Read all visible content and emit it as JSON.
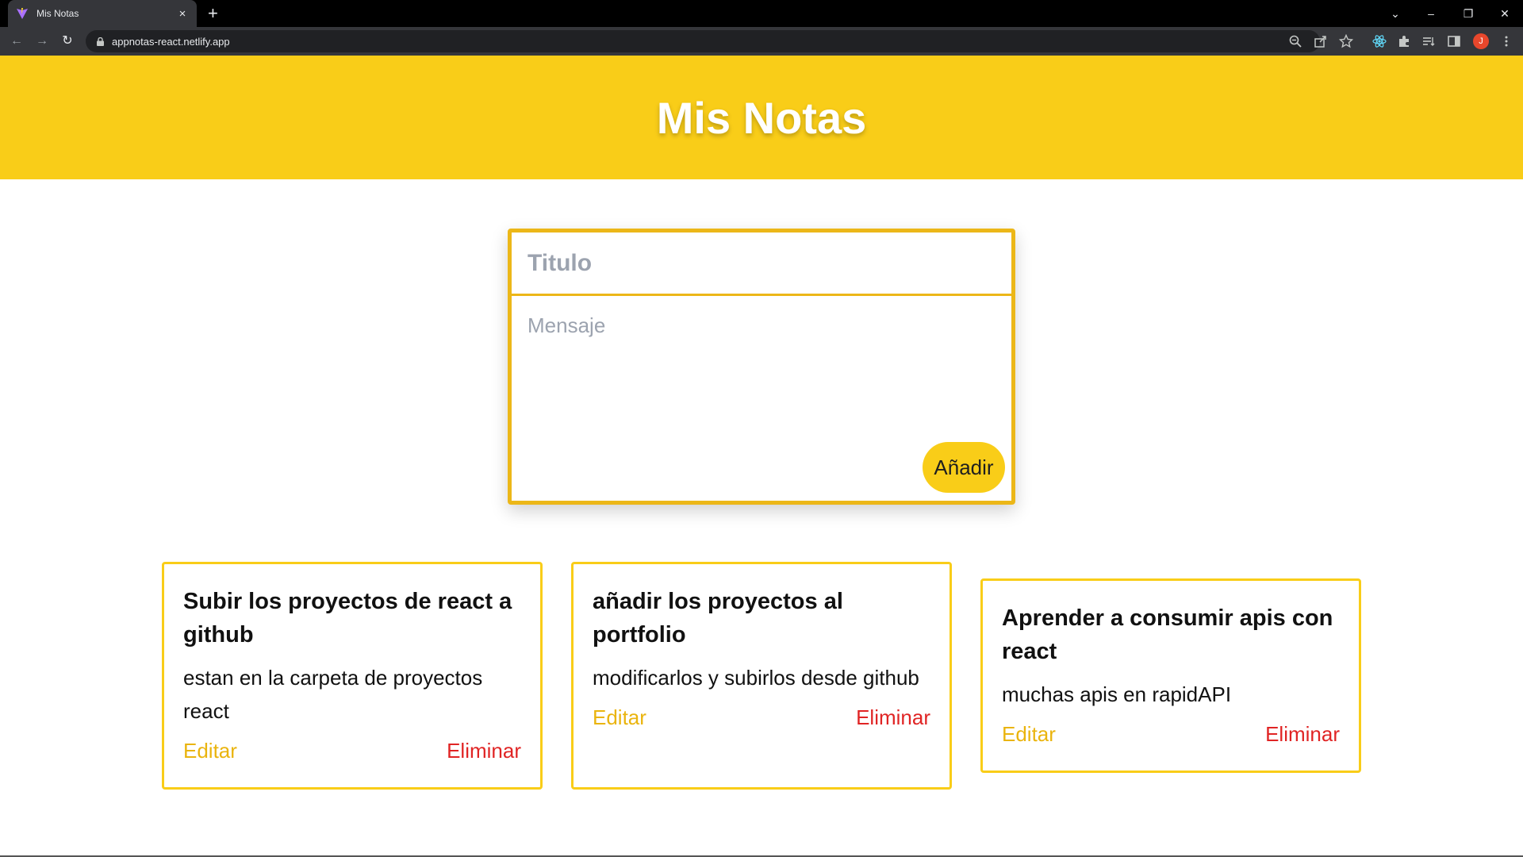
{
  "browser": {
    "tab_title": "Mis Notas",
    "tab_close": "×",
    "new_tab": "+",
    "url": "appnotas-react.netlify.app",
    "profile_initial": "J",
    "window_controls": {
      "tab_search": "⌄",
      "minimize": "–",
      "restore": "❐",
      "close": "✕"
    },
    "nav": {
      "back": "←",
      "forward": "→",
      "reload": "↻"
    },
    "toolbar_icons": [
      "zoom-icon",
      "share-icon",
      "bookmark-star-icon",
      "react-devtools-icon",
      "extensions-icon",
      "reading-list-icon",
      "side-panel-icon",
      "menu-icon"
    ]
  },
  "header": {
    "title": "Mis Notas"
  },
  "form": {
    "title_placeholder": "Titulo",
    "message_placeholder": "Mensaje",
    "submit_label": "Añadir"
  },
  "notes": [
    {
      "title": "Subir los proyectos de react a github",
      "body": "estan en la carpeta de proyectos react",
      "edit_label": "Editar",
      "delete_label": "Eliminar"
    },
    {
      "title": "añadir los proyectos al portfolio",
      "body": "modificarlos y subirlos desde github",
      "edit_label": "Editar",
      "delete_label": "Eliminar"
    },
    {
      "title": "Aprender a consumir apis con react",
      "body": "muchas apis en rapidAPI",
      "edit_label": "Editar",
      "delete_label": "Eliminar"
    }
  ],
  "colors": {
    "accent": "#f9cd18",
    "border": "#ecb718",
    "edit": "#eab40e",
    "delete": "#e02424"
  }
}
